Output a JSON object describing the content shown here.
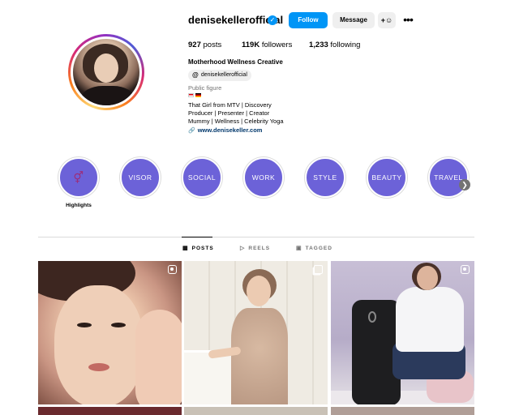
{
  "profile": {
    "username": "denisekellerofficial",
    "verified": true,
    "follow_label": "Follow",
    "message_label": "Message",
    "add_user_label": "+¦",
    "stats": {
      "posts_count": "927",
      "posts_label": "posts",
      "followers_count": "119K",
      "followers_label": "followers",
      "following_count": "1,233",
      "following_label": "following"
    },
    "full_name": "Motherhood Wellness Creative",
    "threads_handle": "denisekellerofficial",
    "category": "Public figure",
    "bio_lines": [
      "That Girl from MTV | Discovery",
      "Producer | Presenter | Creator",
      "Mummy | Wellness | Celebrity Yoga"
    ],
    "website": "www.denisekeller.com"
  },
  "highlights": [
    {
      "label": "Highlights",
      "circle_text": ""
    },
    {
      "label": "",
      "circle_text": "VISOR"
    },
    {
      "label": "",
      "circle_text": "SOCIAL"
    },
    {
      "label": "",
      "circle_text": "WORK"
    },
    {
      "label": "",
      "circle_text": "STYLE"
    },
    {
      "label": "",
      "circle_text": "BEAUTY"
    },
    {
      "label": "",
      "circle_text": "TRAVEL"
    }
  ],
  "tabs": [
    {
      "label": "POSTS",
      "active": true,
      "icon": "grid-icon"
    },
    {
      "label": "REELS",
      "active": false,
      "icon": "reels-icon"
    },
    {
      "label": "TAGGED",
      "active": false,
      "icon": "tagged-icon"
    }
  ],
  "colors": {
    "accent": "#0095f6",
    "highlight_circle": "#6c62d8",
    "link": "#00376b",
    "secondary_text": "#737373"
  },
  "posts": [
    {
      "badge": "reel-icon"
    },
    {
      "badge": "carousel-icon"
    },
    {
      "badge": "reel-icon"
    }
  ]
}
